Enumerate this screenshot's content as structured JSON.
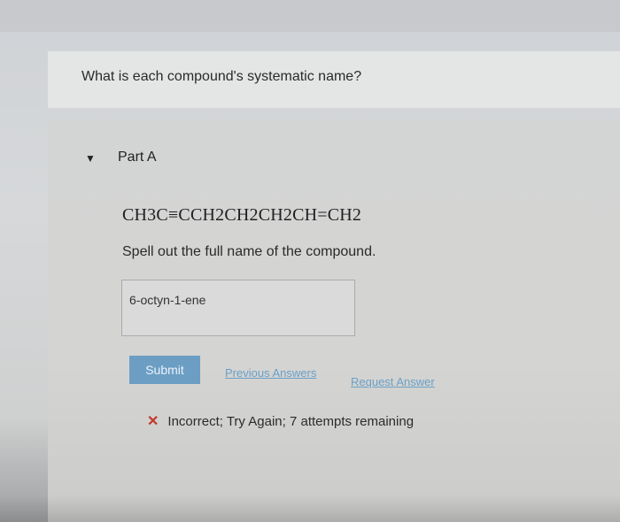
{
  "question": {
    "text": "What is each compound's systematic name?"
  },
  "part": {
    "toggle_icon": "triangle-down-icon",
    "title": "Part A"
  },
  "compound": {
    "formula": "CH3C≡CCH2CH2CH2CH=CH2"
  },
  "prompt": {
    "instruction": "Spell out the full name of the compound."
  },
  "answer": {
    "value": "6-octyn-1-ene"
  },
  "actions": {
    "submit_label": "Submit",
    "previous_answers_label": "Previous Answers",
    "request_answer_label": "Request Answer"
  },
  "feedback": {
    "icon": "x-icon",
    "text": "Incorrect; Try Again; 7 attempts remaining",
    "icon_color": "#c0392b"
  },
  "colors": {
    "submit_bg": "#6c9ec4",
    "link": "#6aa0c8"
  }
}
